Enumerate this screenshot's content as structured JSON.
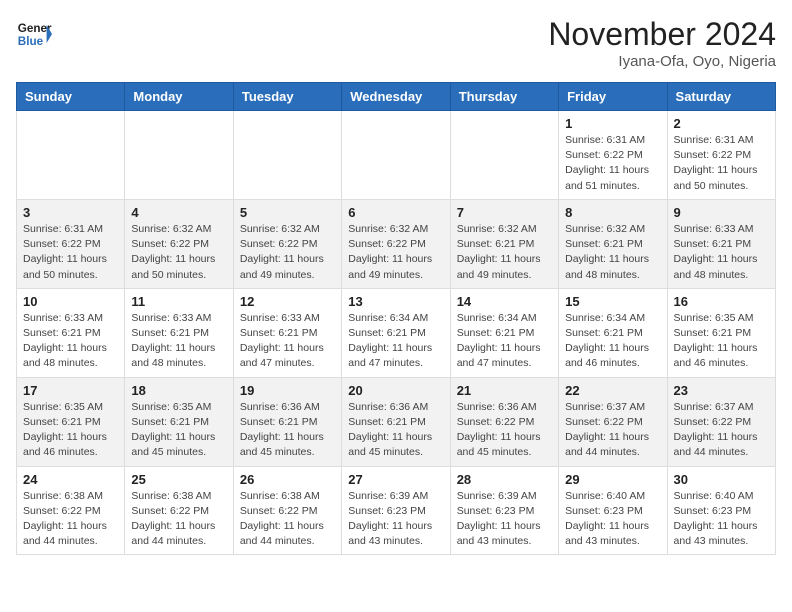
{
  "header": {
    "logo_line1": "General",
    "logo_line2": "Blue",
    "month": "November 2024",
    "location": "Iyana-Ofa, Oyo, Nigeria"
  },
  "weekdays": [
    "Sunday",
    "Monday",
    "Tuesday",
    "Wednesday",
    "Thursday",
    "Friday",
    "Saturday"
  ],
  "weeks": [
    [
      {
        "day": "",
        "info": ""
      },
      {
        "day": "",
        "info": ""
      },
      {
        "day": "",
        "info": ""
      },
      {
        "day": "",
        "info": ""
      },
      {
        "day": "",
        "info": ""
      },
      {
        "day": "1",
        "info": "Sunrise: 6:31 AM\nSunset: 6:22 PM\nDaylight: 11 hours\nand 51 minutes."
      },
      {
        "day": "2",
        "info": "Sunrise: 6:31 AM\nSunset: 6:22 PM\nDaylight: 11 hours\nand 50 minutes."
      }
    ],
    [
      {
        "day": "3",
        "info": "Sunrise: 6:31 AM\nSunset: 6:22 PM\nDaylight: 11 hours\nand 50 minutes."
      },
      {
        "day": "4",
        "info": "Sunrise: 6:32 AM\nSunset: 6:22 PM\nDaylight: 11 hours\nand 50 minutes."
      },
      {
        "day": "5",
        "info": "Sunrise: 6:32 AM\nSunset: 6:22 PM\nDaylight: 11 hours\nand 49 minutes."
      },
      {
        "day": "6",
        "info": "Sunrise: 6:32 AM\nSunset: 6:22 PM\nDaylight: 11 hours\nand 49 minutes."
      },
      {
        "day": "7",
        "info": "Sunrise: 6:32 AM\nSunset: 6:21 PM\nDaylight: 11 hours\nand 49 minutes."
      },
      {
        "day": "8",
        "info": "Sunrise: 6:32 AM\nSunset: 6:21 PM\nDaylight: 11 hours\nand 48 minutes."
      },
      {
        "day": "9",
        "info": "Sunrise: 6:33 AM\nSunset: 6:21 PM\nDaylight: 11 hours\nand 48 minutes."
      }
    ],
    [
      {
        "day": "10",
        "info": "Sunrise: 6:33 AM\nSunset: 6:21 PM\nDaylight: 11 hours\nand 48 minutes."
      },
      {
        "day": "11",
        "info": "Sunrise: 6:33 AM\nSunset: 6:21 PM\nDaylight: 11 hours\nand 48 minutes."
      },
      {
        "day": "12",
        "info": "Sunrise: 6:33 AM\nSunset: 6:21 PM\nDaylight: 11 hours\nand 47 minutes."
      },
      {
        "day": "13",
        "info": "Sunrise: 6:34 AM\nSunset: 6:21 PM\nDaylight: 11 hours\nand 47 minutes."
      },
      {
        "day": "14",
        "info": "Sunrise: 6:34 AM\nSunset: 6:21 PM\nDaylight: 11 hours\nand 47 minutes."
      },
      {
        "day": "15",
        "info": "Sunrise: 6:34 AM\nSunset: 6:21 PM\nDaylight: 11 hours\nand 46 minutes."
      },
      {
        "day": "16",
        "info": "Sunrise: 6:35 AM\nSunset: 6:21 PM\nDaylight: 11 hours\nand 46 minutes."
      }
    ],
    [
      {
        "day": "17",
        "info": "Sunrise: 6:35 AM\nSunset: 6:21 PM\nDaylight: 11 hours\nand 46 minutes."
      },
      {
        "day": "18",
        "info": "Sunrise: 6:35 AM\nSunset: 6:21 PM\nDaylight: 11 hours\nand 45 minutes."
      },
      {
        "day": "19",
        "info": "Sunrise: 6:36 AM\nSunset: 6:21 PM\nDaylight: 11 hours\nand 45 minutes."
      },
      {
        "day": "20",
        "info": "Sunrise: 6:36 AM\nSunset: 6:21 PM\nDaylight: 11 hours\nand 45 minutes."
      },
      {
        "day": "21",
        "info": "Sunrise: 6:36 AM\nSunset: 6:22 PM\nDaylight: 11 hours\nand 45 minutes."
      },
      {
        "day": "22",
        "info": "Sunrise: 6:37 AM\nSunset: 6:22 PM\nDaylight: 11 hours\nand 44 minutes."
      },
      {
        "day": "23",
        "info": "Sunrise: 6:37 AM\nSunset: 6:22 PM\nDaylight: 11 hours\nand 44 minutes."
      }
    ],
    [
      {
        "day": "24",
        "info": "Sunrise: 6:38 AM\nSunset: 6:22 PM\nDaylight: 11 hours\nand 44 minutes."
      },
      {
        "day": "25",
        "info": "Sunrise: 6:38 AM\nSunset: 6:22 PM\nDaylight: 11 hours\nand 44 minutes."
      },
      {
        "day": "26",
        "info": "Sunrise: 6:38 AM\nSunset: 6:22 PM\nDaylight: 11 hours\nand 44 minutes."
      },
      {
        "day": "27",
        "info": "Sunrise: 6:39 AM\nSunset: 6:23 PM\nDaylight: 11 hours\nand 43 minutes."
      },
      {
        "day": "28",
        "info": "Sunrise: 6:39 AM\nSunset: 6:23 PM\nDaylight: 11 hours\nand 43 minutes."
      },
      {
        "day": "29",
        "info": "Sunrise: 6:40 AM\nSunset: 6:23 PM\nDaylight: 11 hours\nand 43 minutes."
      },
      {
        "day": "30",
        "info": "Sunrise: 6:40 AM\nSunset: 6:23 PM\nDaylight: 11 hours\nand 43 minutes."
      }
    ]
  ]
}
